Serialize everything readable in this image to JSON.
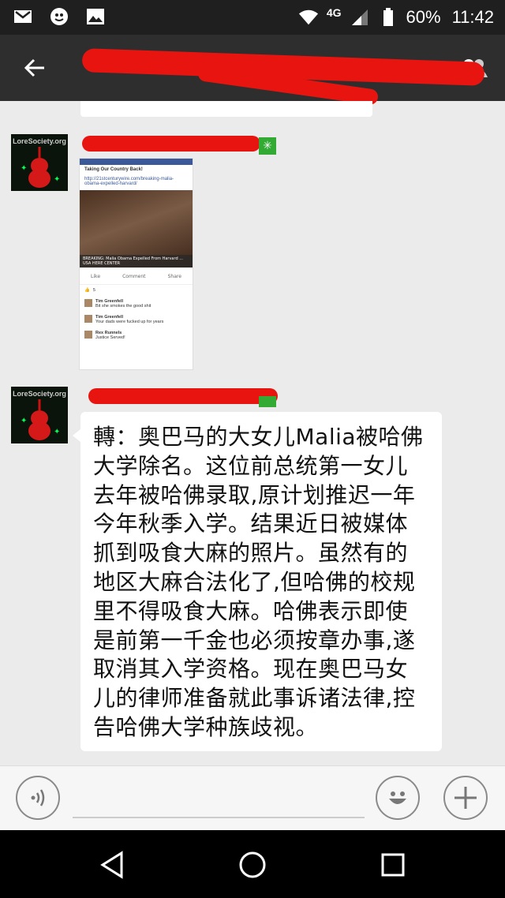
{
  "status_bar": {
    "network": "4G",
    "battery": "60%",
    "time": "11:42",
    "icons": [
      "gmail-icon",
      "app-notification-icon",
      "gallery-icon",
      "wifi-icon",
      "signal-icon",
      "battery-icon"
    ]
  },
  "header": {
    "back_icon": "arrow-left-icon",
    "members_icon": "group-members-icon"
  },
  "messages": [
    {
      "type": "image",
      "avatar_label": "LoreSociety.org",
      "screenshot": {
        "post_title": "Taking Our Country Back!",
        "link": "http://21stcenturywire.com/breaking-malia-obama-expelled-harvard/",
        "caption": "BREAKING: Malia Obama Expelled From Harvard ... USA HERE CENTER",
        "actions": [
          "Like",
          "Comment",
          "Share"
        ],
        "reactions": "5",
        "comments": [
          {
            "name": "Tim Greenfell",
            "text": "Bit she smokes the good shit"
          },
          {
            "name": "Tim Greenfell",
            "text": "Your dads were fucked up for years"
          },
          {
            "name": "Rex Runnels",
            "text": "Justice Served!"
          }
        ]
      }
    },
    {
      "type": "text",
      "avatar_label": "LoreSociety.org",
      "text": "轉：奥巴马的大女儿Malia被哈佛大学除名。这位前总统第一女儿去年被哈佛录取,原计划推迟一年今年秋季入学。结果近日被媒体抓到吸食大麻的照片。虽然有的地区大麻合法化了,但哈佛的校规里不得吸食大麻。哈佛表示即使是前第一千金也必须按章办事,遂取消其入学资格。现在奥巴马女儿的律师准备就此事诉诸法律,控告哈佛大学种族歧视。"
    }
  ],
  "input_bar": {
    "voice_icon": "voice-input-icon",
    "emoji_icon": "emoji-icon",
    "plus_icon": "plus-icon"
  },
  "nav_bar": {
    "icons": [
      "back-triangle-icon",
      "home-circle-icon",
      "recents-square-icon"
    ]
  },
  "colors": {
    "status_bar": "#1f1f1f",
    "header": "#2e2e2e",
    "chat_bg": "#ebebeb",
    "redaction": "#e8140f"
  }
}
